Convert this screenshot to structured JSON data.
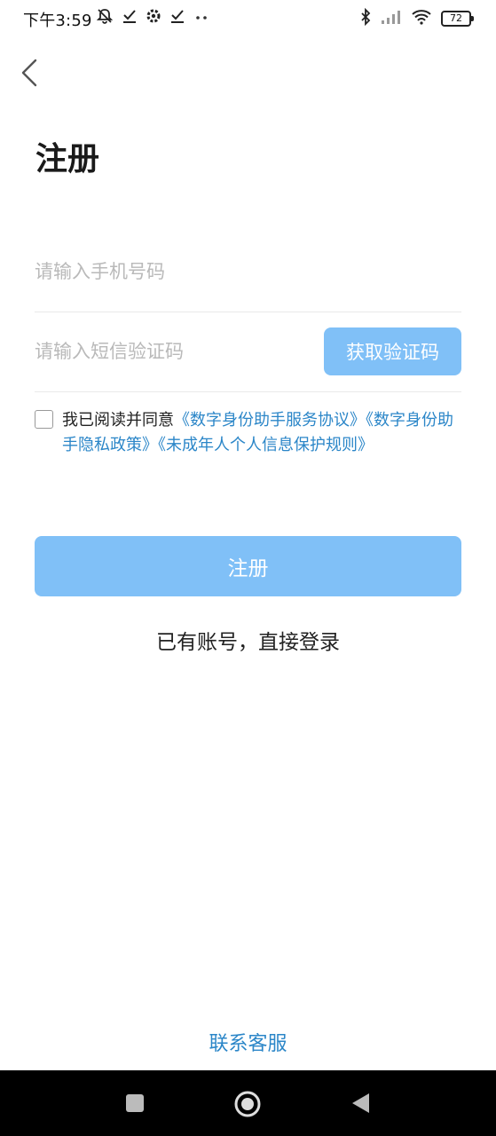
{
  "status_bar": {
    "time": "下午3:59",
    "battery": "72",
    "icons": [
      "notifications-off-icon",
      "check-icon",
      "settings-icon",
      "check-icon",
      "more-dots-icon",
      "bluetooth-icon",
      "signal-icon",
      "wifi-icon",
      "battery-icon"
    ]
  },
  "header": {
    "back_icon": "chevron-left-icon",
    "title": "注册"
  },
  "form": {
    "phone_placeholder": "请输入手机号码",
    "code_placeholder": "请输入短信验证码",
    "get_code_label": "获取验证码"
  },
  "agreement": {
    "prefix": "我已阅读并同意",
    "link1": "《数字身份助手服务协议》",
    "link2": "《数字身份助手隐私政策》",
    "link3": "《未成年人个人信息保护规则》",
    "checked": false
  },
  "actions": {
    "register_label": "注册",
    "login_label": "已有账号，直接登录",
    "support_label": "联系客服"
  },
  "colors": {
    "button": "#80c0f7",
    "link": "#2b86c8"
  },
  "nav_bar": {
    "icons": [
      "square-recents-icon",
      "circle-home-icon",
      "triangle-back-icon"
    ]
  }
}
